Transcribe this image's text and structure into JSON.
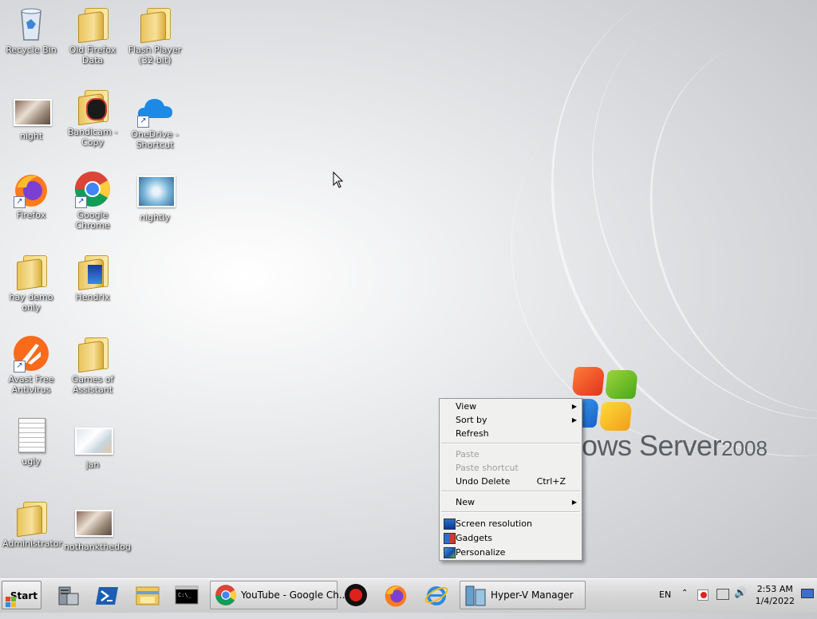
{
  "desktop": {
    "icons": [
      {
        "label": "Recycle Bin",
        "icon": "recycle-bin-icon"
      },
      {
        "label": "Old Firefox Data",
        "icon": "folder-icon"
      },
      {
        "label": "Flash Player (32-bit)",
        "icon": "folder-icon"
      },
      {
        "label": "night",
        "icon": "image-file-icon"
      },
      {
        "label": "Bandicam - Copy",
        "icon": "folder-icon"
      },
      {
        "label": "OneDrive - Shortcut",
        "icon": "onedrive-icon"
      },
      {
        "label": "Firefox",
        "icon": "firefox-icon"
      },
      {
        "label": "Google Chrome",
        "icon": "chrome-icon"
      },
      {
        "label": "nightly",
        "icon": "nightly-icon"
      },
      {
        "label": "hay demo only",
        "icon": "folder-icon"
      },
      {
        "label": "Hendrix",
        "icon": "folder-icon"
      },
      {
        "label": "Avast Free Antivirus",
        "icon": "avast-icon"
      },
      {
        "label": "Games of Assistant",
        "icon": "folder-icon"
      },
      {
        "label": "ugly",
        "icon": "text-document-icon"
      },
      {
        "label": "jan",
        "icon": "image-file-icon"
      },
      {
        "label": "Administrator",
        "icon": "folder-icon"
      },
      {
        "label": "nothankthedog",
        "icon": "image-file-icon"
      }
    ]
  },
  "branding": {
    "text": "ows Server",
    "version": "2008"
  },
  "context_menu": {
    "items": [
      {
        "label": "View",
        "submenu": true,
        "enabled": true
      },
      {
        "label": "Sort by",
        "submenu": true,
        "enabled": true
      },
      {
        "label": "Refresh",
        "enabled": true
      },
      {
        "label": "Paste",
        "enabled": false
      },
      {
        "label": "Paste shortcut",
        "enabled": false
      },
      {
        "label": "Undo Delete",
        "shortcut": "Ctrl+Z",
        "enabled": true
      },
      {
        "label": "New",
        "submenu": true,
        "enabled": true
      },
      {
        "label": "Screen resolution",
        "icon": "screen-resolution-icon",
        "enabled": true
      },
      {
        "label": "Gadgets",
        "icon": "gadgets-icon",
        "enabled": true
      },
      {
        "label": "Personalize",
        "icon": "personalize-icon",
        "enabled": true
      }
    ]
  },
  "taskbar": {
    "start_label": "Start",
    "buttons": [
      {
        "label": "",
        "icon": "server-manager-icon"
      },
      {
        "label": "",
        "icon": "powershell-icon"
      },
      {
        "label": "",
        "icon": "file-explorer-icon"
      },
      {
        "label": "",
        "icon": "command-prompt-icon"
      },
      {
        "label": "YouTube - Google Ch...",
        "icon": "chrome-icon"
      },
      {
        "label": "",
        "icon": "record-icon"
      },
      {
        "label": "",
        "icon": "firefox-icon"
      },
      {
        "label": "",
        "icon": "internet-explorer-icon"
      },
      {
        "label": "Hyper-V Manager",
        "icon": "hyper-v-icon"
      }
    ],
    "language": "EN",
    "time": "2:53 AM",
    "date": "1/4/2022"
  },
  "colors": {
    "selection_blue": "#3399ff",
    "taskbar": "#d6d6d6"
  }
}
